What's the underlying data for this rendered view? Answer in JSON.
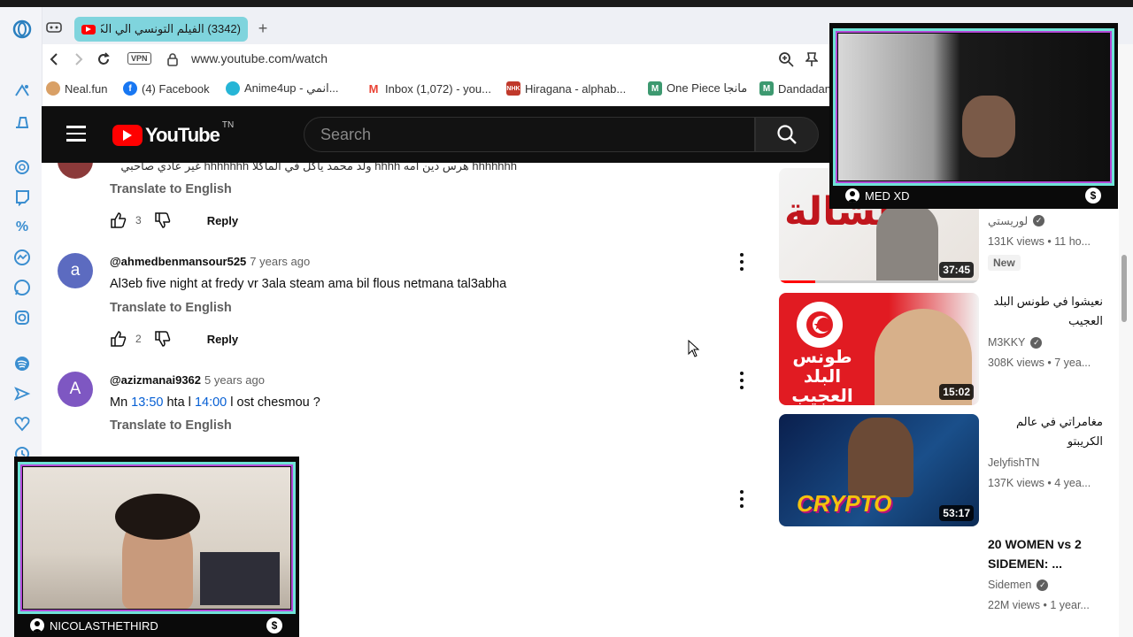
{
  "browser": {
    "tab": {
      "title": "(3342) الفيلم التونسي الي الكا..."
    },
    "address": {
      "vpn_label": "VPN",
      "url": "www.youtube.com/watch"
    },
    "bookmarks": [
      {
        "label": "Neal.fun",
        "color": "#d9a066"
      },
      {
        "label": "(4) Facebook",
        "color": "#1877f2"
      },
      {
        "label": "Anime4up - انمي...",
        "color": "#26b5d6"
      },
      {
        "label": "Inbox (1,072) - you...",
        "color": "#ea4335"
      },
      {
        "label": "Hiragana - alphab...",
        "color": "#c0392b"
      },
      {
        "label": "One Piece مانجا",
        "color": "#3d9970"
      },
      {
        "label": "Dandadan",
        "color": "#3d9970"
      }
    ]
  },
  "youtube": {
    "logo_text": "YouTube",
    "country_code": "TN",
    "search_placeholder": "Search"
  },
  "comments": [
    {
      "text": "hhhhhhh هرس دين امه hhhh ولد محمد  ياكل في الماكلا hhhhhhh غير عادي صاحبي",
      "translate": "Translate to English",
      "likes": "3",
      "reply": "Reply"
    },
    {
      "avatar_letter": "a",
      "avatar_color": "#5c6bc0",
      "author": "@ahmedbenmansour525",
      "time": "7 years ago",
      "text": "Al3eb five night at fredy  vr  3ala steam ama bil flous netmana tal3abha",
      "translate": "Translate to English",
      "likes": "2",
      "reply": "Reply"
    },
    {
      "avatar_letter": "A",
      "avatar_color": "#7e57c2",
      "author": "@azizmanai9362",
      "time": "5 years ago",
      "text_before": "Mn ",
      "ts1": "13:50",
      "text_mid": " hta l ",
      "ts2": "14:00",
      "text_after": " l ost chesmou ?",
      "translate": "Translate to English"
    }
  ],
  "recommendations": [
    {
      "title": "",
      "channel": "لوريستي",
      "stats": "131K views • 11 ho...",
      "badge": "New",
      "duration": "37:45",
      "thumb_text": "الشالة"
    },
    {
      "title": "نعيشوا في طونس البلد العجيب",
      "channel": "M3KKY",
      "stats": "308K views • 7 yea...",
      "duration": "15:02",
      "thumb_text": "طونس البلد العجيب"
    },
    {
      "title": "مغامراتي في عالم الكريبتو",
      "channel": "JelyfishTN",
      "stats": "137K views • 4 yea...",
      "duration": "53:17",
      "thumb_text": "CRYPTO"
    },
    {
      "title": "20 WOMEN vs 2 SIDEMEN: ...",
      "channel": "Sidemen",
      "stats": "22M views • 1 year..."
    }
  ],
  "webcams": {
    "top": {
      "name": "MED XD"
    },
    "bottom": {
      "name": "NICOLASTHETHIRD"
    }
  },
  "colors": {
    "youtube_red": "#ff0000",
    "cam_border": "#6fe3d7",
    "cam_accent": "#b44ad6",
    "tab_active": "#7fd4dd"
  }
}
